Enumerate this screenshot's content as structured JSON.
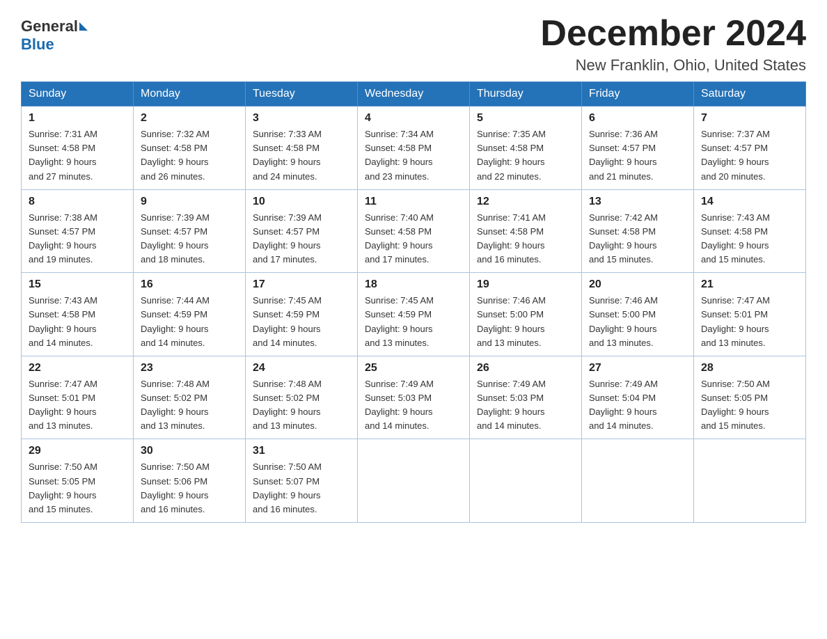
{
  "header": {
    "logo_general": "General",
    "logo_blue": "Blue",
    "title": "December 2024",
    "subtitle": "New Franklin, Ohio, United States"
  },
  "days_of_week": [
    "Sunday",
    "Monday",
    "Tuesday",
    "Wednesday",
    "Thursday",
    "Friday",
    "Saturday"
  ],
  "weeks": [
    [
      {
        "day": "1",
        "sunrise": "7:31 AM",
        "sunset": "4:58 PM",
        "daylight": "9 hours and 27 minutes."
      },
      {
        "day": "2",
        "sunrise": "7:32 AM",
        "sunset": "4:58 PM",
        "daylight": "9 hours and 26 minutes."
      },
      {
        "day": "3",
        "sunrise": "7:33 AM",
        "sunset": "4:58 PM",
        "daylight": "9 hours and 24 minutes."
      },
      {
        "day": "4",
        "sunrise": "7:34 AM",
        "sunset": "4:58 PM",
        "daylight": "9 hours and 23 minutes."
      },
      {
        "day": "5",
        "sunrise": "7:35 AM",
        "sunset": "4:58 PM",
        "daylight": "9 hours and 22 minutes."
      },
      {
        "day": "6",
        "sunrise": "7:36 AM",
        "sunset": "4:57 PM",
        "daylight": "9 hours and 21 minutes."
      },
      {
        "day": "7",
        "sunrise": "7:37 AM",
        "sunset": "4:57 PM",
        "daylight": "9 hours and 20 minutes."
      }
    ],
    [
      {
        "day": "8",
        "sunrise": "7:38 AM",
        "sunset": "4:57 PM",
        "daylight": "9 hours and 19 minutes."
      },
      {
        "day": "9",
        "sunrise": "7:39 AM",
        "sunset": "4:57 PM",
        "daylight": "9 hours and 18 minutes."
      },
      {
        "day": "10",
        "sunrise": "7:39 AM",
        "sunset": "4:57 PM",
        "daylight": "9 hours and 17 minutes."
      },
      {
        "day": "11",
        "sunrise": "7:40 AM",
        "sunset": "4:58 PM",
        "daylight": "9 hours and 17 minutes."
      },
      {
        "day": "12",
        "sunrise": "7:41 AM",
        "sunset": "4:58 PM",
        "daylight": "9 hours and 16 minutes."
      },
      {
        "day": "13",
        "sunrise": "7:42 AM",
        "sunset": "4:58 PM",
        "daylight": "9 hours and 15 minutes."
      },
      {
        "day": "14",
        "sunrise": "7:43 AM",
        "sunset": "4:58 PM",
        "daylight": "9 hours and 15 minutes."
      }
    ],
    [
      {
        "day": "15",
        "sunrise": "7:43 AM",
        "sunset": "4:58 PM",
        "daylight": "9 hours and 14 minutes."
      },
      {
        "day": "16",
        "sunrise": "7:44 AM",
        "sunset": "4:59 PM",
        "daylight": "9 hours and 14 minutes."
      },
      {
        "day": "17",
        "sunrise": "7:45 AM",
        "sunset": "4:59 PM",
        "daylight": "9 hours and 14 minutes."
      },
      {
        "day": "18",
        "sunrise": "7:45 AM",
        "sunset": "4:59 PM",
        "daylight": "9 hours and 13 minutes."
      },
      {
        "day": "19",
        "sunrise": "7:46 AM",
        "sunset": "5:00 PM",
        "daylight": "9 hours and 13 minutes."
      },
      {
        "day": "20",
        "sunrise": "7:46 AM",
        "sunset": "5:00 PM",
        "daylight": "9 hours and 13 minutes."
      },
      {
        "day": "21",
        "sunrise": "7:47 AM",
        "sunset": "5:01 PM",
        "daylight": "9 hours and 13 minutes."
      }
    ],
    [
      {
        "day": "22",
        "sunrise": "7:47 AM",
        "sunset": "5:01 PM",
        "daylight": "9 hours and 13 minutes."
      },
      {
        "day": "23",
        "sunrise": "7:48 AM",
        "sunset": "5:02 PM",
        "daylight": "9 hours and 13 minutes."
      },
      {
        "day": "24",
        "sunrise": "7:48 AM",
        "sunset": "5:02 PM",
        "daylight": "9 hours and 13 minutes."
      },
      {
        "day": "25",
        "sunrise": "7:49 AM",
        "sunset": "5:03 PM",
        "daylight": "9 hours and 14 minutes."
      },
      {
        "day": "26",
        "sunrise": "7:49 AM",
        "sunset": "5:03 PM",
        "daylight": "9 hours and 14 minutes."
      },
      {
        "day": "27",
        "sunrise": "7:49 AM",
        "sunset": "5:04 PM",
        "daylight": "9 hours and 14 minutes."
      },
      {
        "day": "28",
        "sunrise": "7:50 AM",
        "sunset": "5:05 PM",
        "daylight": "9 hours and 15 minutes."
      }
    ],
    [
      {
        "day": "29",
        "sunrise": "7:50 AM",
        "sunset": "5:05 PM",
        "daylight": "9 hours and 15 minutes."
      },
      {
        "day": "30",
        "sunrise": "7:50 AM",
        "sunset": "5:06 PM",
        "daylight": "9 hours and 16 minutes."
      },
      {
        "day": "31",
        "sunrise": "7:50 AM",
        "sunset": "5:07 PM",
        "daylight": "9 hours and 16 minutes."
      },
      null,
      null,
      null,
      null
    ]
  ],
  "labels": {
    "sunrise": "Sunrise:",
    "sunset": "Sunset:",
    "daylight": "Daylight:"
  }
}
